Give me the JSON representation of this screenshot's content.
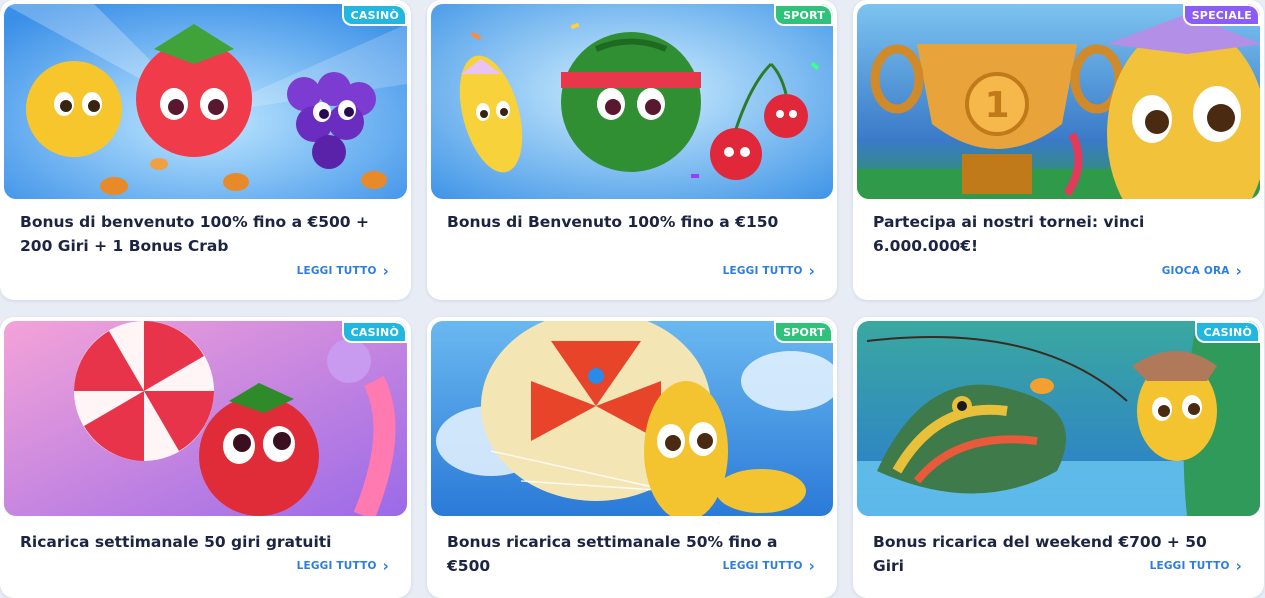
{
  "promotions": [
    {
      "badge": "CASINÒ",
      "badge_color": "#22b7e0",
      "title": "Bonus di benvenuto 100% fino a €500 + 200 Giri + 1 Bonus Crab",
      "cta": "LEGGI TUTTO"
    },
    {
      "badge": "SPORT",
      "badge_color": "#2fc27a",
      "title": "Bonus di Benvenuto 100% fino a €150",
      "cta": "LEGGI TUTTO"
    },
    {
      "badge": "SPECIALE",
      "badge_color": "#8b5cf6",
      "title": "Partecipa ai nostri tornei: vinci 6.000.000€!",
      "cta": "GIOCA ORA"
    },
    {
      "badge": "CASINÒ",
      "badge_color": "#22b7e0",
      "title": "Ricarica settimanale 50 giri gratuiti",
      "cta": "LEGGI TUTTO"
    },
    {
      "badge": "SPORT",
      "badge_color": "#2fc27a",
      "title": "Bonus ricarica settimanale 50% fino a €500",
      "cta": "LEGGI TUTTO"
    },
    {
      "badge": "CASINÒ",
      "badge_color": "#22b7e0",
      "title": "Bonus ricarica del weekend €700 + 50 Giri",
      "cta": "LEGGI TUTTO"
    }
  ],
  "icons": {
    "cta_icon": "chevron-right-icon"
  },
  "trophy_number": "1"
}
